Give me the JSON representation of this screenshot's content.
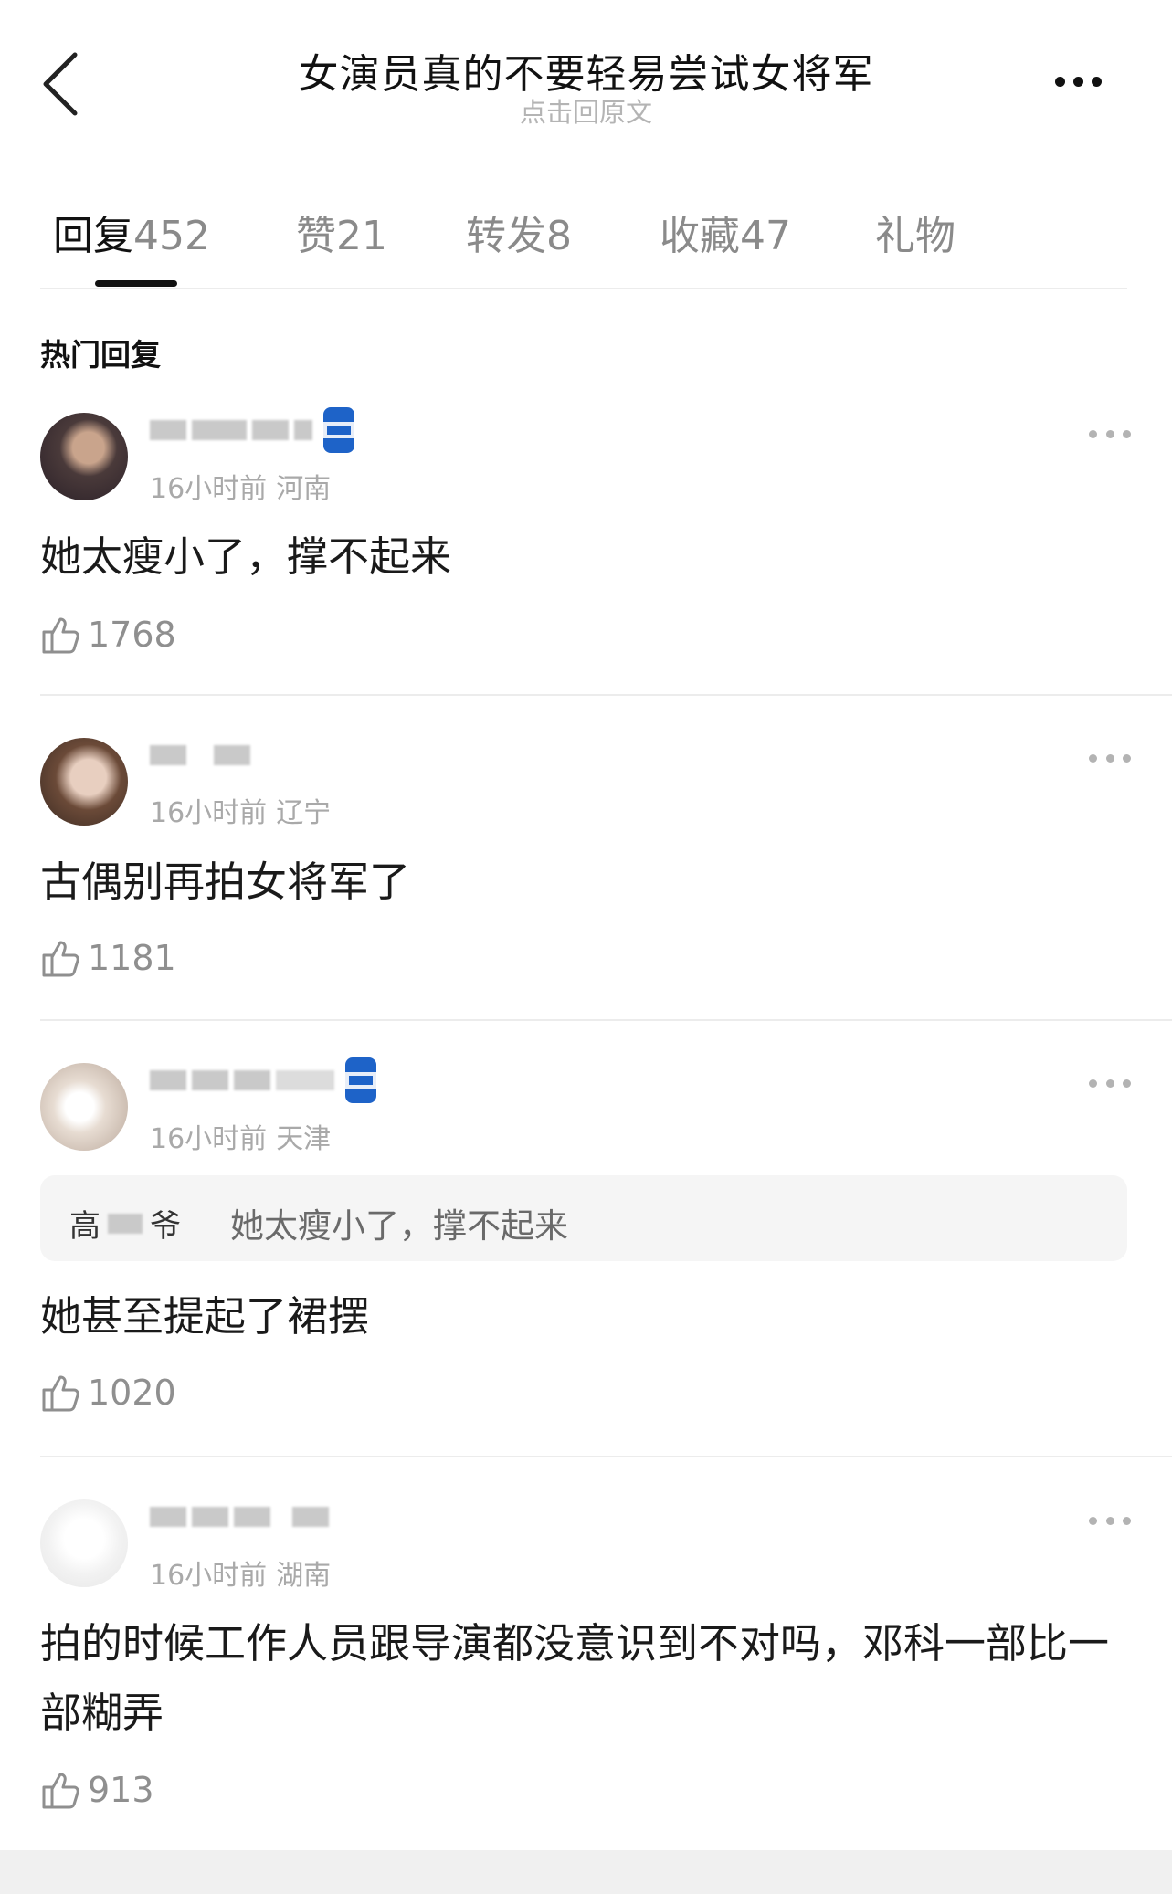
{
  "header": {
    "title": "女演员真的不要轻易尝试女将军",
    "subtitle": "点击回原文"
  },
  "tabs": [
    {
      "name": "回复",
      "count": "452",
      "active": true
    },
    {
      "name": "赞",
      "count": "21"
    },
    {
      "name": "转发",
      "count": "8"
    },
    {
      "name": "收藏",
      "count": "47"
    },
    {
      "name": "礼物",
      "count": ""
    }
  ],
  "section_title": "热门回复",
  "comments": [
    {
      "time": "16小时前",
      "location": "河南",
      "text": "她太瘦小了，撑不起来",
      "likes": "1768"
    },
    {
      "time": "16小时前",
      "location": "辽宁",
      "text": "古偶别再拍女将军了",
      "likes": "1181"
    },
    {
      "time": "16小时前",
      "location": "天津",
      "text": "她甚至提起了裙摆",
      "likes": "1020",
      "quote": {
        "user_fragment_1": "高",
        "user_fragment_2": "爷",
        "text": "她太瘦小了，撑不起来"
      }
    },
    {
      "time": "16小时前",
      "location": "湖南",
      "text": "拍的时候工作人员跟导演都没意识到不对吗，邓科一部比一部糊弄",
      "likes": "913"
    }
  ],
  "icons": {
    "back": "chevron-left-icon",
    "more": "more-horizontal-icon",
    "like": "thumbs-up-icon",
    "badge": "can-badge-icon"
  },
  "colors": {
    "text_primary": "#111111",
    "text_secondary": "#a9a9a9",
    "tab_inactive": "#8a8a8a",
    "quote_bg": "#f5f5f5"
  }
}
